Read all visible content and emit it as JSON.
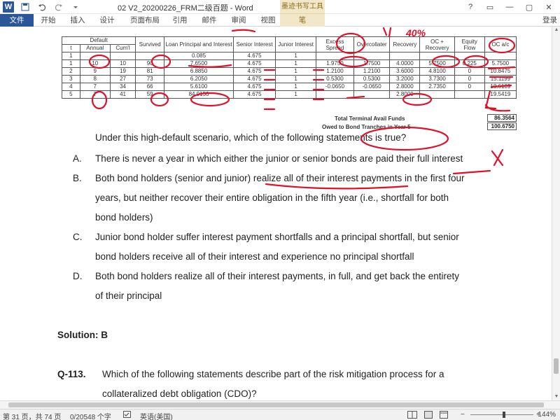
{
  "titlebar": {
    "app_icon": "W",
    "qat_icons": [
      "save-icon",
      "undo-icon",
      "redo-icon",
      "customize-icon"
    ],
    "title": "02 V2_20200226_FRM二级百题 - Word",
    "context_tab_header": "墨迹书写工具",
    "window_buttons": [
      "?",
      "▭",
      "—",
      "▢",
      "✕"
    ]
  },
  "ribbon": {
    "tabs": [
      "文件",
      "开始",
      "插入",
      "设计",
      "页面布局",
      "引用",
      "邮件",
      "审阅",
      "视图",
      "笔"
    ],
    "login": "登录"
  },
  "table": {
    "group_header": "Default",
    "headers": [
      "t",
      "Annual",
      "Cum'l",
      "Survived",
      "Loan Principal and Interest",
      "Senior Interest",
      "Junior Interest",
      "Excess Spread",
      "Overcollater",
      "Recovery",
      "OC + Recovery",
      "Equity Flow",
      "OC a/c"
    ],
    "rows": [
      [
        "1",
        "",
        "",
        "",
        "0.085",
        "4.675",
        "1",
        "",
        "",
        "",
        "",
        "",
        ""
      ],
      [
        "1",
        "10",
        "10",
        "90",
        "7.6500",
        "4.675",
        "1",
        "1.9750",
        "1.7500",
        "4.0000",
        "5.7500",
        "0.225",
        "5.7500"
      ],
      [
        "2",
        "9",
        "19",
        "81",
        "6.8850",
        "4.675",
        "1",
        "1.2100",
        "1.2100",
        "3.6000",
        "4.8100",
        "0",
        "10.8475"
      ],
      [
        "3",
        "8",
        "27",
        "73",
        "6.2050",
        "4.675",
        "1",
        "0.5300",
        "0.5300",
        "3.2000",
        "3.7300",
        "0",
        "15.1199"
      ],
      [
        "4",
        "7",
        "34",
        "66",
        "5.6100",
        "4.675",
        "1",
        "-0.0650",
        "-0.0650",
        "2.8000",
        "2.7350",
        "0",
        "18.6109"
      ],
      [
        "5",
        "7",
        "41",
        "59",
        "84.0150",
        "4.675",
        "1",
        "",
        "",
        "2.8000",
        "",
        "",
        "19.5419"
      ]
    ],
    "summary_label_1": "Total Terminal Avail Funds",
    "summary_value_1": "86.3564",
    "summary_label_2": "Owed to Bond Tranches in Year 5",
    "summary_value_2": "100.6750"
  },
  "question": {
    "stem": "Under this high-default scenario, which of the following statements is true?",
    "options": [
      {
        "letter": "A.",
        "lines": [
          "There is never a year in which either the junior or senior bonds are paid their full interest"
        ]
      },
      {
        "letter": "B.",
        "lines": [
          "Both bond holders (senior and junior) realize all of their interest payments in the first four",
          "years, but neither recover their entire obligation in the fifth year (i.e., shortfall for both",
          "bond holders)"
        ]
      },
      {
        "letter": "C.",
        "lines": [
          "Junior bond holder suffer interest payment shortfalls and a principal shortfall, but senior",
          "bond holders receive all of their interest and experience no principal shortfall"
        ]
      },
      {
        "letter": "D.",
        "lines": [
          "Both bond holders realize all of their interest payments, in full, and get back the entirety",
          "of their principal"
        ]
      }
    ],
    "solution": "Solution: B"
  },
  "next_question": {
    "number": "Q-113.",
    "lines": [
      "Which of the following statements describe part of the risk mitigation process for a",
      "collateralized debt obligation (CDO)?"
    ]
  },
  "annotations": {
    "handwritten_note": "40%"
  },
  "statusbar": {
    "page": "第 31 页，共 74 页",
    "words": "0/20548 个字",
    "language": "英语(美国)",
    "zoom": "144%"
  },
  "colors": {
    "ink": "#e0102a",
    "word_blue": "#2b579a",
    "context_tab": "#f2e8c9"
  }
}
